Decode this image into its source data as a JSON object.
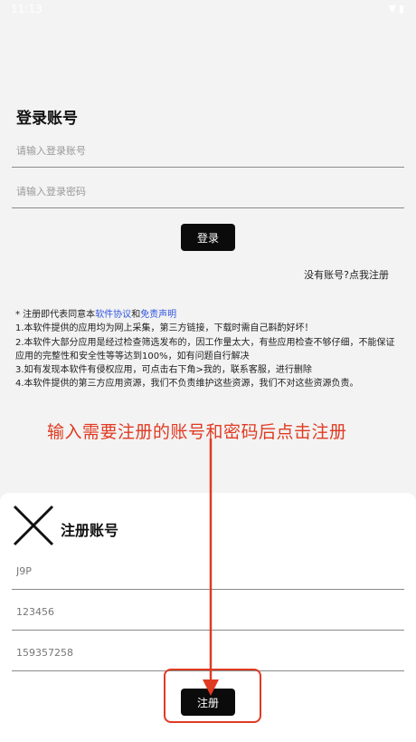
{
  "status_bar": {
    "time": "11:13"
  },
  "login": {
    "title": "登录账号",
    "account_placeholder": "请输入登录账号",
    "password_placeholder": "请输入登录密码",
    "login_button": "登录",
    "register_link": "没有账号?点我注册"
  },
  "notice": {
    "prefix": "* 注册即代表同意本",
    "agreement_link": "软件协议",
    "and": "和",
    "disclaimer_link": "免责声明",
    "lines": [
      "1.本软件提供的应用均为网上采集，第三方链接，下载时需自己斟酌好坏！",
      "2.本软件大部分应用是经过检查筛选发布的，因工作量太大，有些应用检查不够仔细，不能保证应用的完整性和安全性等等达到100%，如有问题自行解决",
      "3.如有发现本软件有侵权应用，可点击右下角>我的，联系客服，进行删除",
      "4.本软件提供的第三方应用资源，我们不负责维护这些资源，我们不对这些资源负责。"
    ]
  },
  "annotation": {
    "text": "输入需要注册的账号和密码后点击注册"
  },
  "register_sheet": {
    "title": "注册账号",
    "username_value": "J9P",
    "password_value": "123456",
    "phone_value": "159357258",
    "register_button": "注册"
  },
  "colors": {
    "annotation": "#e03a22",
    "link": "#2f55e0",
    "button": "#0b0b0b"
  }
}
